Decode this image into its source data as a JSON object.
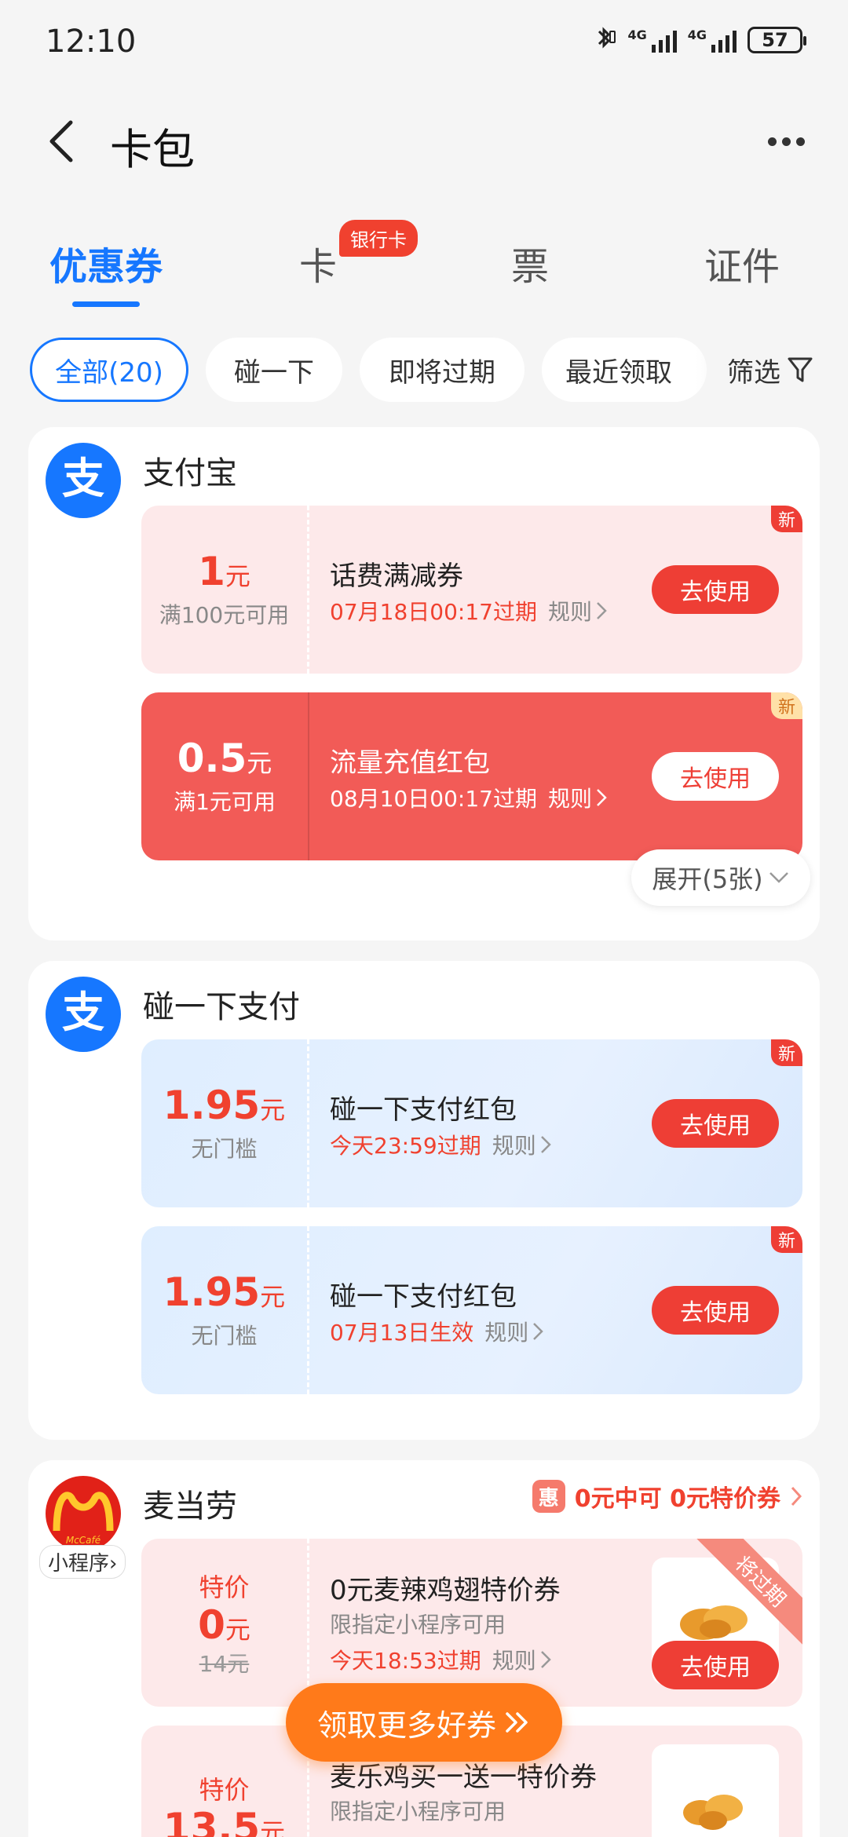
{
  "status": {
    "time": "12:10",
    "battery": "57",
    "net1": "4G",
    "net2": "4G"
  },
  "header": {
    "title": "卡包"
  },
  "tabs": [
    {
      "label": "优惠券"
    },
    {
      "label": "卡"
    },
    {
      "label": "票"
    },
    {
      "label": "证件"
    }
  ],
  "tab_badge": "银行卡",
  "filters": {
    "chips": [
      "全部(20)",
      "碰一下",
      "即将过期",
      "最近领取"
    ],
    "filter_label": "筛选"
  },
  "groups": {
    "alipay": {
      "name": "支付宝",
      "logo_glyph": "支",
      "expand_label": "展开(5张)",
      "coupons": [
        {
          "amount": "1",
          "unit": "元",
          "condition": "满100元可用",
          "title": "话费满减券",
          "expiry": "07月18日00:17过期",
          "rule": "规则",
          "action": "去使用",
          "tag": "新"
        },
        {
          "amount": "0.5",
          "unit": "元",
          "condition": "满1元可用",
          "title": "流量充值红包",
          "expiry": "08月10日00:17过期",
          "rule": "规则",
          "action": "去使用",
          "tag": "新"
        }
      ]
    },
    "tap_pay": {
      "name": "碰一下支付",
      "logo_glyph": "支",
      "coupons": [
        {
          "amount": "1.95",
          "unit": "元",
          "condition": "无门槛",
          "title": "碰一下支付红包",
          "expiry": "今天23:59过期",
          "rule": "规则",
          "action": "去使用",
          "tag": "新"
        },
        {
          "amount": "1.95",
          "unit": "元",
          "condition": "无门槛",
          "title": "碰一下支付红包",
          "expiry": "07月13日生效",
          "rule": "规则",
          "action": "去使用",
          "tag": "新"
        }
      ]
    },
    "mcd": {
      "name": "麦当劳",
      "logo_text": "McCafé",
      "mini_program": "小程序",
      "promo_badge": "惠",
      "promo": "0元中可 0元特价券",
      "coupons": [
        {
          "label": "特价",
          "amount": "0",
          "unit": "元",
          "original": "14元",
          "title": "0元麦辣鸡翅特价券",
          "scope": "限指定小程序可用",
          "expiry": "今天18:53过期",
          "rule": "规则",
          "action": "去使用",
          "ribbon": "将过期"
        },
        {
          "label": "特价",
          "amount": "13.5",
          "unit": "元",
          "title": "麦乐鸡买一送一特价券",
          "scope": "限指定小程序可用"
        }
      ]
    }
  },
  "float_button": "领取更多好券"
}
